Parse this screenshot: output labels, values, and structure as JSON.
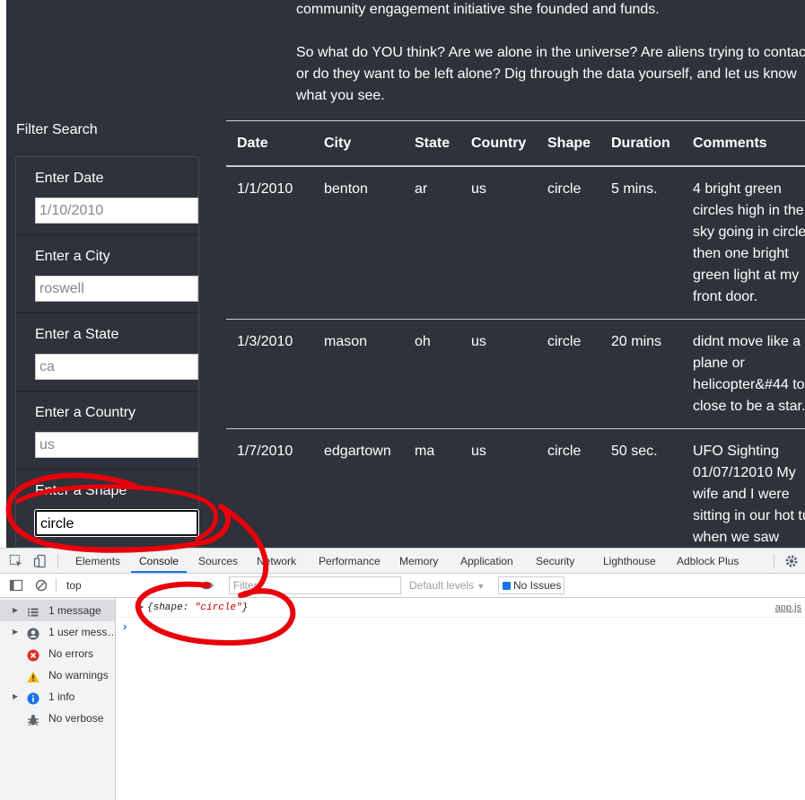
{
  "intro": {
    "line1": "community engagement initiative she founded and funds.",
    "line2": "So what do YOU think? Are we alone in the universe? Are aliens trying to contact us,",
    "line3": "or do they want to be left alone? Dig through the data yourself, and let us know",
    "line4": "what you see."
  },
  "filters": {
    "title": "Filter Search",
    "items": [
      {
        "label": "Enter Date",
        "placeholder": "1/10/2010",
        "value": ""
      },
      {
        "label": "Enter a City",
        "placeholder": "roswell",
        "value": ""
      },
      {
        "label": "Enter a State",
        "placeholder": "ca",
        "value": ""
      },
      {
        "label": "Enter a Country",
        "placeholder": "us",
        "value": ""
      },
      {
        "label": "Enter a Shape",
        "placeholder": "",
        "value": "circle"
      }
    ]
  },
  "table": {
    "headers": [
      "Date",
      "City",
      "State",
      "Country",
      "Shape",
      "Duration",
      "Comments"
    ],
    "rows": [
      {
        "date": "1/1/2010",
        "city": "benton",
        "state": "ar",
        "country": "us",
        "shape": "circle",
        "duration": "5 mins.",
        "comments": "4 bright green circles high in the sky going in circles then one bright green light at my front door."
      },
      {
        "date": "1/3/2010",
        "city": "mason",
        "state": "oh",
        "country": "us",
        "shape": "circle",
        "duration": "20 mins",
        "comments": "didnt move like a plane or helicopter&#44 to close to be a star."
      },
      {
        "date": "1/7/2010",
        "city": "edgartown",
        "state": "ma",
        "country": "us",
        "shape": "circle",
        "duration": "50 sec.",
        "comments": "UFO Sighting 01/07/12010 My wife and I were sitting in our hot tub when we saw"
      }
    ]
  },
  "devtools": {
    "tabs": [
      "Elements",
      "Console",
      "Sources",
      "Network",
      "Performance",
      "Memory",
      "Application",
      "Security",
      "Lighthouse",
      "Adblock Plus"
    ],
    "active_tab": "Console",
    "context": "top",
    "filter_placeholder": "Filter",
    "levels": "Default levels",
    "issues": "No Issues",
    "sidebar": [
      {
        "label": "1 message",
        "icon": "list-icon"
      },
      {
        "label": "1 user mess…",
        "icon": "user-icon"
      },
      {
        "label": "No errors",
        "icon": "error-icon"
      },
      {
        "label": "No warnings",
        "icon": "warning-icon"
      },
      {
        "label": "1 info",
        "icon": "info-icon"
      },
      {
        "label": "No verbose",
        "icon": "bug-icon"
      }
    ],
    "log": {
      "prefix": "{shape: ",
      "string": "\"circle\"",
      "suffix": "}",
      "source": "app.js"
    }
  },
  "colors": {
    "page_bg": "#2f323a",
    "annotation": "#e8000b",
    "accent": "#1a73e8"
  }
}
